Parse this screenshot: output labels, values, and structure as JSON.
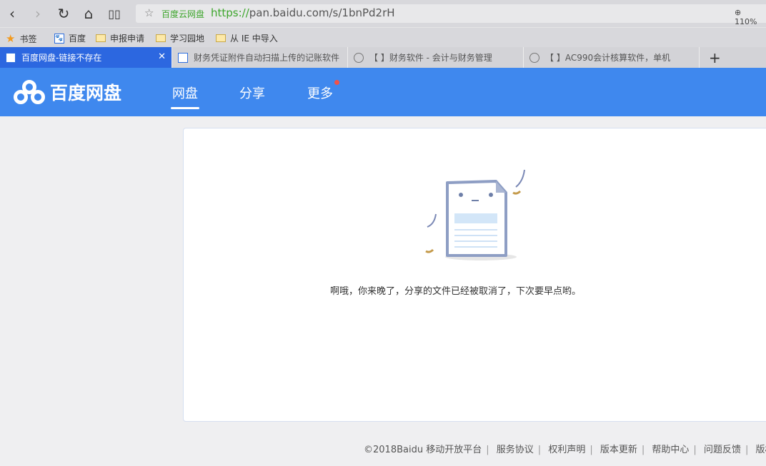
{
  "browser": {
    "site_name": "百度云网盘",
    "url_scheme": "https://",
    "url_rest": "pan.baidu.com/s/1bnPd2rH",
    "zoom": "110%",
    "bookmarks": [
      "书签",
      "百度",
      "申报申请",
      "学习园地",
      "从 IE 中导入"
    ],
    "tabs": [
      {
        "title": "百度网盘-链接不存在"
      },
      {
        "title": "财务凭证附件自动扫描上传的记账软件"
      },
      {
        "title": "【        】财务软件 - 会计与财务管理"
      },
      {
        "title": "【        】AC990会计核算软件，单机"
      }
    ],
    "new_tab": "+"
  },
  "header": {
    "logo": "百度网盘",
    "nav": [
      "网盘",
      "分享",
      "更多"
    ]
  },
  "main": {
    "message": "啊哦，你来晚了，分享的文件已经被取消了，下次要早点哟。"
  },
  "footer": {
    "copyright": "©2018Baidu",
    "links": [
      "移动开放平台",
      "服务协议",
      "权利声明",
      "版本更新",
      "帮助中心",
      "问题反馈",
      "版权投诉"
    ]
  }
}
